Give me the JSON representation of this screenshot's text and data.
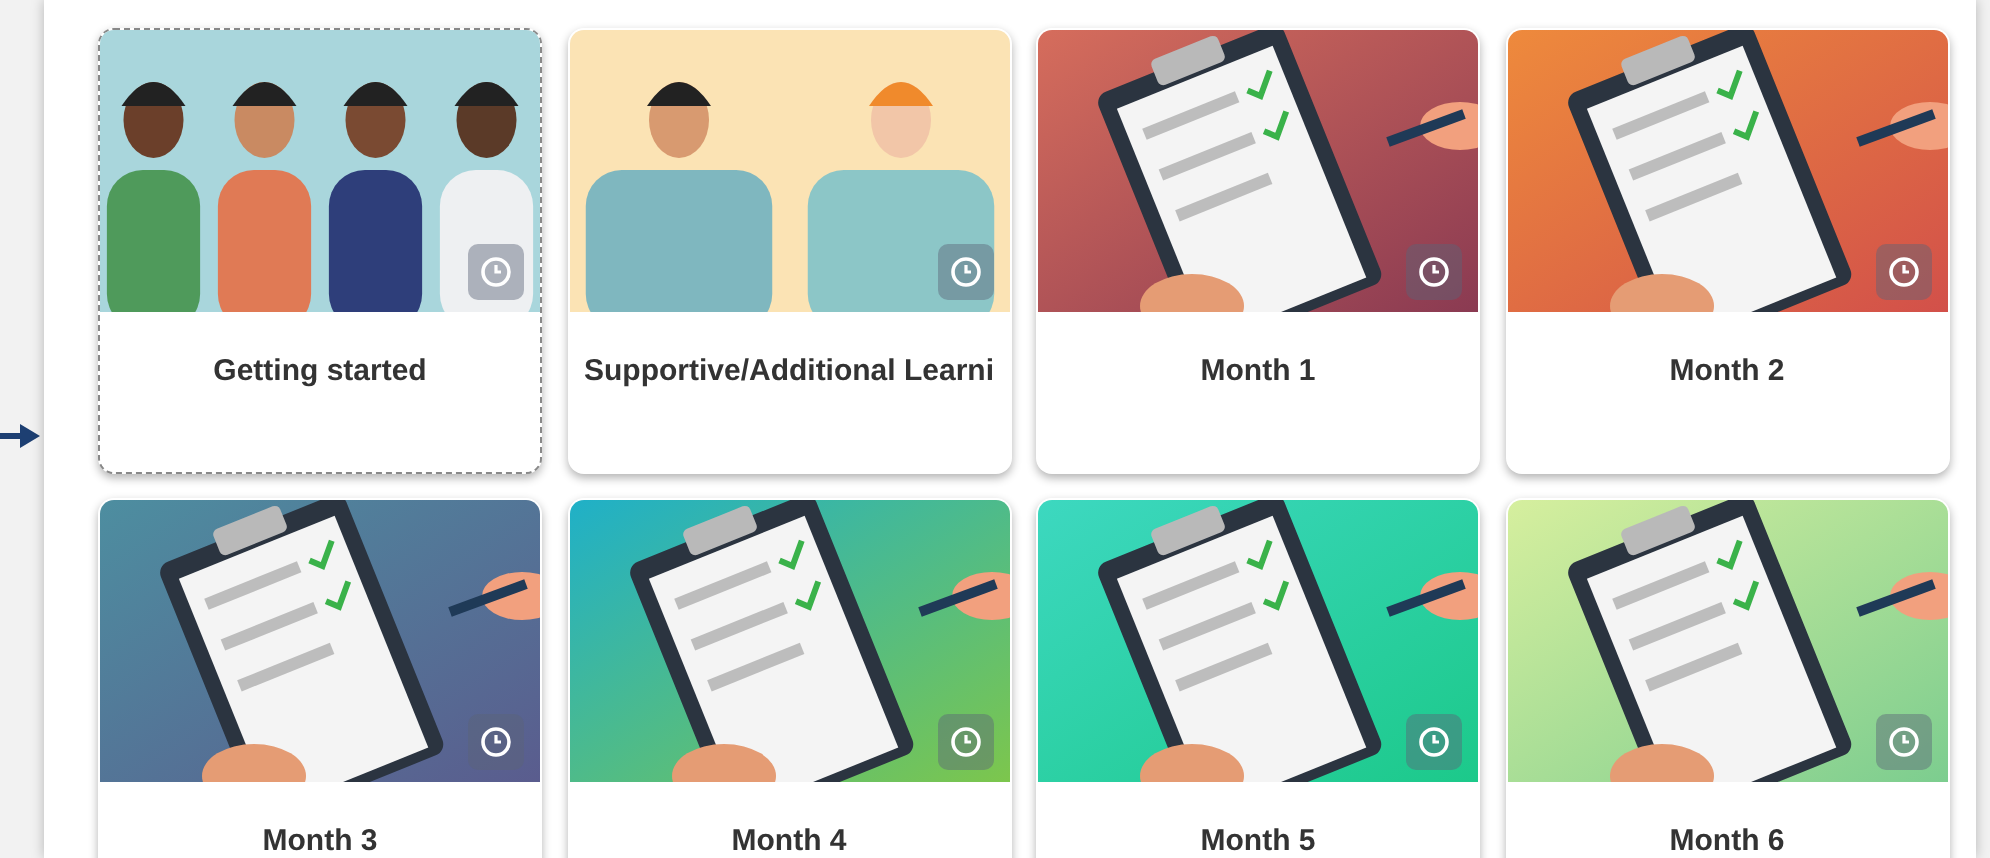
{
  "cards": [
    {
      "title": "Getting started",
      "focused": true
    },
    {
      "title": "Supportive/Additional Learni",
      "focused": false
    },
    {
      "title": "Month 1",
      "focused": false
    },
    {
      "title": "Month 2",
      "focused": false
    },
    {
      "title": "Month 3",
      "focused": false
    },
    {
      "title": "Month 4",
      "focused": false
    },
    {
      "title": "Month 5",
      "focused": false
    },
    {
      "title": "Month 6",
      "focused": false
    }
  ]
}
